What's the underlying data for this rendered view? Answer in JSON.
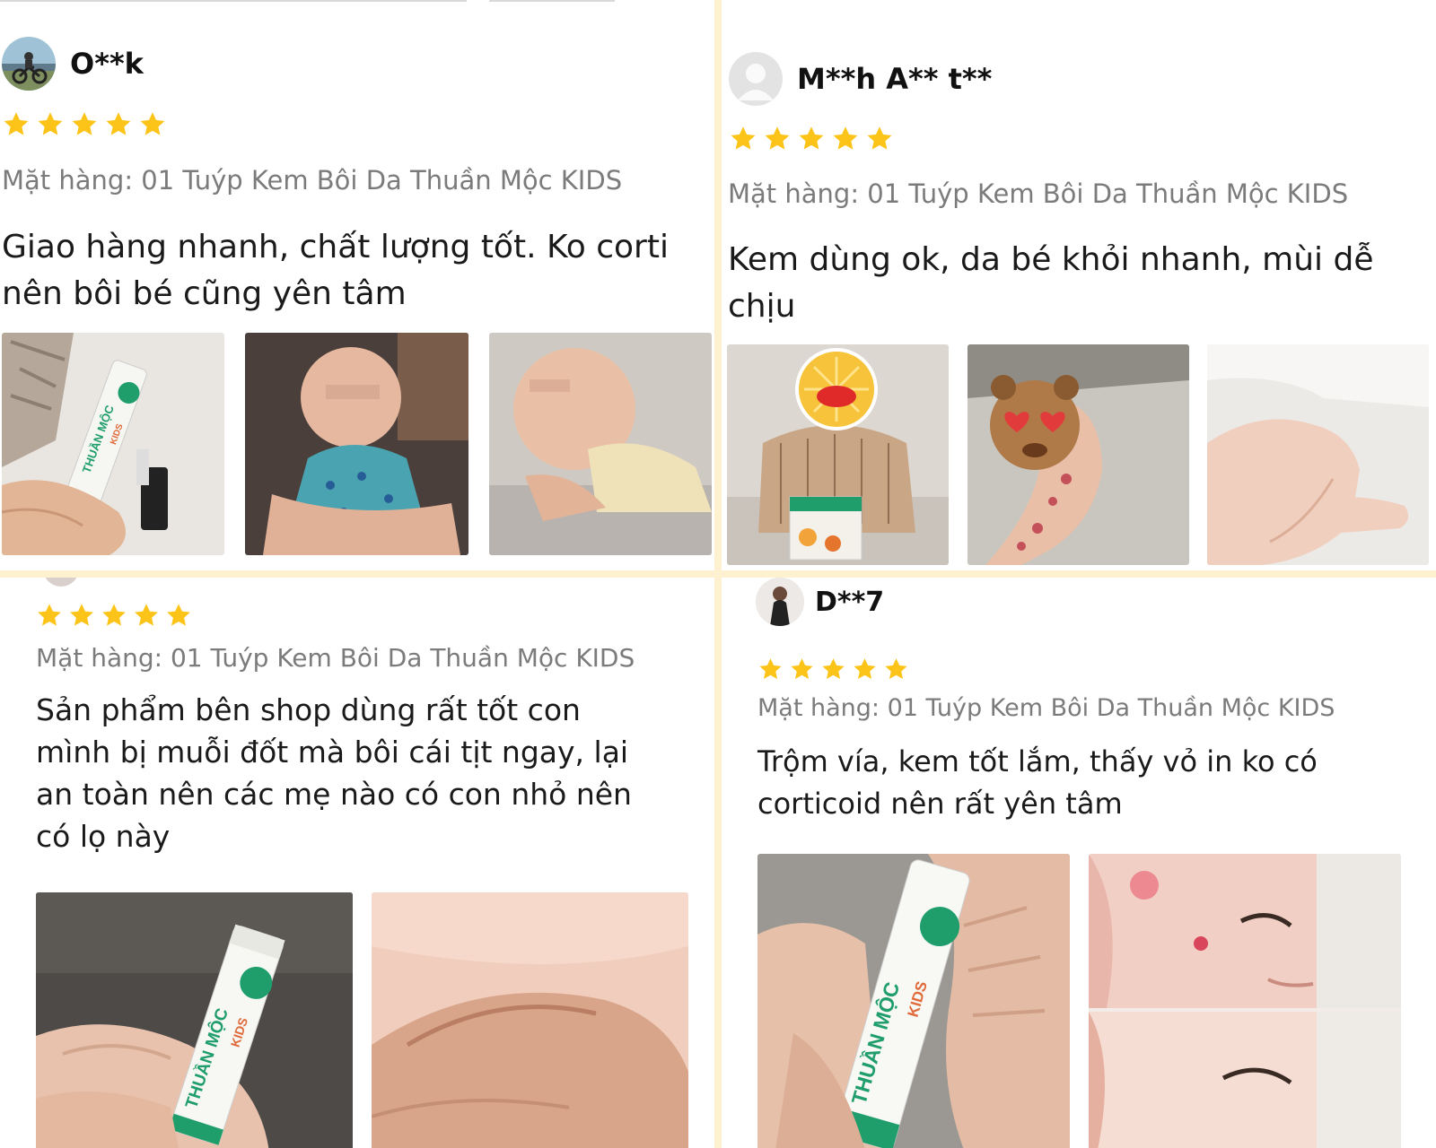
{
  "reviews": [
    {
      "username": "O**k",
      "rating": 5,
      "variant": "Mặt hàng: 01 Tuýp Kem Bôi Da Thuần Mộc KIDS",
      "comment_lines": [
        "Giao hàng nhanh, chất lượng tốt.  Ko corti",
        "nên bôi bé cũng yên tâm"
      ],
      "photos": [
        "product-tube-photo",
        "baby-photo",
        "baby-lying-photo"
      ]
    },
    {
      "username": "M**h A** t**",
      "rating": 5,
      "variant": "Mặt hàng: 01 Tuýp Kem Bôi Da Thuần Mộc KIDS",
      "comment_lines": [
        "Kem dùng ok, da bé khỏi nhanh, mùi dễ",
        "chịu"
      ],
      "photos": [
        "baby-with-box-photo",
        "leg-bites-photo",
        "leg-healed-photo"
      ]
    },
    {
      "username": "",
      "rating": 5,
      "variant": "Mặt hàng: 01 Tuýp Kem Bôi Da Thuần Mộc KIDS",
      "comment_lines": [
        "Sản phẩm bên shop dùng rất tốt con",
        "mình bị muỗi đốt mà bôi cái tịt ngay, lại",
        "an toàn nên các mẹ nào có con nhỏ nên",
        "có lọ này"
      ],
      "photos": [
        "hand-holding-tube-photo",
        "skin-closeup-photo"
      ]
    },
    {
      "username": "D**7",
      "rating": 5,
      "variant": "Mặt hàng: 01 Tuýp Kem Bôi Da Thuần Mộc KIDS",
      "comment_lines": [
        "Trộm vía, kem tốt lắm, thấy vỏ in ko có",
        "corticoid nên rất yên tâm"
      ],
      "photos": [
        "hand-holding-tube-photo",
        "baby-face-collage-photo"
      ]
    }
  ],
  "product_label": "THUẦN MỘC KIDS",
  "colors": {
    "star": "#fcc419",
    "background": "#fdf1cf",
    "variant_text": "#7b7b7b",
    "tube_green": "#1f9e6c"
  }
}
